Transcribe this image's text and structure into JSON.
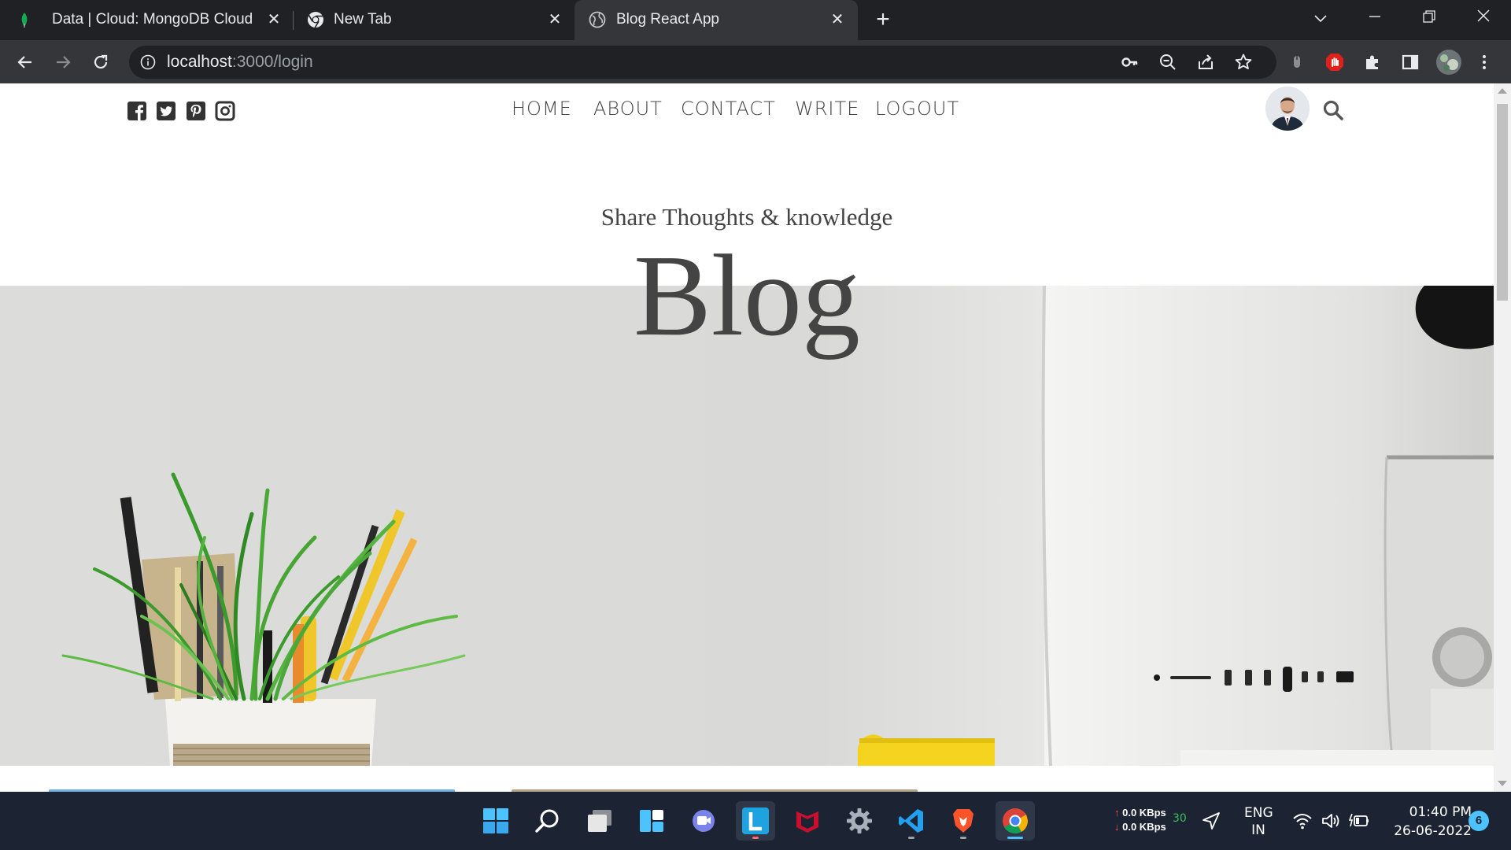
{
  "browser": {
    "tabs": [
      {
        "title": "Data | Cloud: MongoDB Cloud",
        "active": false
      },
      {
        "title": "New Tab",
        "active": false
      },
      {
        "title": "Blog React App",
        "active": true
      }
    ],
    "url_host": "localhost",
    "url_path": ":3000/login"
  },
  "site": {
    "nav_links": [
      "HOME",
      "ABOUT",
      "CONTACT",
      "WRITE",
      "LOGOUT"
    ],
    "hero_subtitle": "Share Thoughts & knowledge",
    "hero_title": "Blog"
  },
  "taskbar": {
    "net_up": "0.0 KBps",
    "net_down": "0.0 KBps",
    "net_extra": "30",
    "lang_line1": "ENG",
    "lang_line2": "IN",
    "time": "01:40 PM",
    "date": "26-06-2022",
    "notification_count": "6"
  },
  "colors": {
    "chrome_dark": "#202124",
    "chrome_toolbar": "#35363a",
    "nav_text": "#444444",
    "taskbar": "#1c2333",
    "notification_badge": "#4cc2ff"
  }
}
